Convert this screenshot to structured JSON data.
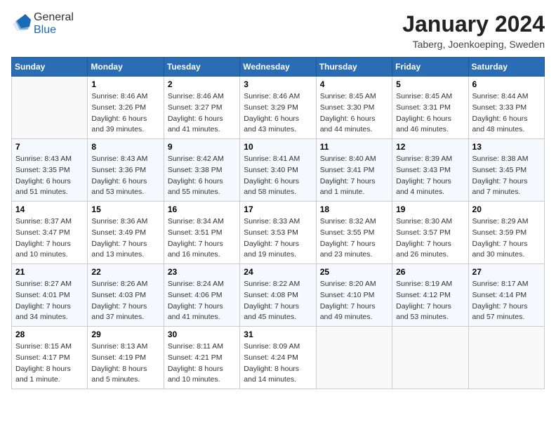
{
  "header": {
    "logo": {
      "general": "General",
      "blue": "Blue"
    },
    "title": "January 2024",
    "location": "Taberg, Joenkoeping, Sweden"
  },
  "days_of_week": [
    "Sunday",
    "Monday",
    "Tuesday",
    "Wednesday",
    "Thursday",
    "Friday",
    "Saturday"
  ],
  "weeks": [
    [
      {
        "num": "",
        "sunrise": "",
        "sunset": "",
        "daylight": "",
        "empty": true
      },
      {
        "num": "1",
        "sunrise": "Sunrise: 8:46 AM",
        "sunset": "Sunset: 3:26 PM",
        "daylight": "Daylight: 6 hours and 39 minutes."
      },
      {
        "num": "2",
        "sunrise": "Sunrise: 8:46 AM",
        "sunset": "Sunset: 3:27 PM",
        "daylight": "Daylight: 6 hours and 41 minutes."
      },
      {
        "num": "3",
        "sunrise": "Sunrise: 8:46 AM",
        "sunset": "Sunset: 3:29 PM",
        "daylight": "Daylight: 6 hours and 43 minutes."
      },
      {
        "num": "4",
        "sunrise": "Sunrise: 8:45 AM",
        "sunset": "Sunset: 3:30 PM",
        "daylight": "Daylight: 6 hours and 44 minutes."
      },
      {
        "num": "5",
        "sunrise": "Sunrise: 8:45 AM",
        "sunset": "Sunset: 3:31 PM",
        "daylight": "Daylight: 6 hours and 46 minutes."
      },
      {
        "num": "6",
        "sunrise": "Sunrise: 8:44 AM",
        "sunset": "Sunset: 3:33 PM",
        "daylight": "Daylight: 6 hours and 48 minutes."
      }
    ],
    [
      {
        "num": "7",
        "sunrise": "Sunrise: 8:43 AM",
        "sunset": "Sunset: 3:35 PM",
        "daylight": "Daylight: 6 hours and 51 minutes."
      },
      {
        "num": "8",
        "sunrise": "Sunrise: 8:43 AM",
        "sunset": "Sunset: 3:36 PM",
        "daylight": "Daylight: 6 hours and 53 minutes."
      },
      {
        "num": "9",
        "sunrise": "Sunrise: 8:42 AM",
        "sunset": "Sunset: 3:38 PM",
        "daylight": "Daylight: 6 hours and 55 minutes."
      },
      {
        "num": "10",
        "sunrise": "Sunrise: 8:41 AM",
        "sunset": "Sunset: 3:40 PM",
        "daylight": "Daylight: 6 hours and 58 minutes."
      },
      {
        "num": "11",
        "sunrise": "Sunrise: 8:40 AM",
        "sunset": "Sunset: 3:41 PM",
        "daylight": "Daylight: 7 hours and 1 minute."
      },
      {
        "num": "12",
        "sunrise": "Sunrise: 8:39 AM",
        "sunset": "Sunset: 3:43 PM",
        "daylight": "Daylight: 7 hours and 4 minutes."
      },
      {
        "num": "13",
        "sunrise": "Sunrise: 8:38 AM",
        "sunset": "Sunset: 3:45 PM",
        "daylight": "Daylight: 7 hours and 7 minutes."
      }
    ],
    [
      {
        "num": "14",
        "sunrise": "Sunrise: 8:37 AM",
        "sunset": "Sunset: 3:47 PM",
        "daylight": "Daylight: 7 hours and 10 minutes."
      },
      {
        "num": "15",
        "sunrise": "Sunrise: 8:36 AM",
        "sunset": "Sunset: 3:49 PM",
        "daylight": "Daylight: 7 hours and 13 minutes."
      },
      {
        "num": "16",
        "sunrise": "Sunrise: 8:34 AM",
        "sunset": "Sunset: 3:51 PM",
        "daylight": "Daylight: 7 hours and 16 minutes."
      },
      {
        "num": "17",
        "sunrise": "Sunrise: 8:33 AM",
        "sunset": "Sunset: 3:53 PM",
        "daylight": "Daylight: 7 hours and 19 minutes."
      },
      {
        "num": "18",
        "sunrise": "Sunrise: 8:32 AM",
        "sunset": "Sunset: 3:55 PM",
        "daylight": "Daylight: 7 hours and 23 minutes."
      },
      {
        "num": "19",
        "sunrise": "Sunrise: 8:30 AM",
        "sunset": "Sunset: 3:57 PM",
        "daylight": "Daylight: 7 hours and 26 minutes."
      },
      {
        "num": "20",
        "sunrise": "Sunrise: 8:29 AM",
        "sunset": "Sunset: 3:59 PM",
        "daylight": "Daylight: 7 hours and 30 minutes."
      }
    ],
    [
      {
        "num": "21",
        "sunrise": "Sunrise: 8:27 AM",
        "sunset": "Sunset: 4:01 PM",
        "daylight": "Daylight: 7 hours and 34 minutes."
      },
      {
        "num": "22",
        "sunrise": "Sunrise: 8:26 AM",
        "sunset": "Sunset: 4:03 PM",
        "daylight": "Daylight: 7 hours and 37 minutes."
      },
      {
        "num": "23",
        "sunrise": "Sunrise: 8:24 AM",
        "sunset": "Sunset: 4:06 PM",
        "daylight": "Daylight: 7 hours and 41 minutes."
      },
      {
        "num": "24",
        "sunrise": "Sunrise: 8:22 AM",
        "sunset": "Sunset: 4:08 PM",
        "daylight": "Daylight: 7 hours and 45 minutes."
      },
      {
        "num": "25",
        "sunrise": "Sunrise: 8:20 AM",
        "sunset": "Sunset: 4:10 PM",
        "daylight": "Daylight: 7 hours and 49 minutes."
      },
      {
        "num": "26",
        "sunrise": "Sunrise: 8:19 AM",
        "sunset": "Sunset: 4:12 PM",
        "daylight": "Daylight: 7 hours and 53 minutes."
      },
      {
        "num": "27",
        "sunrise": "Sunrise: 8:17 AM",
        "sunset": "Sunset: 4:14 PM",
        "daylight": "Daylight: 7 hours and 57 minutes."
      }
    ],
    [
      {
        "num": "28",
        "sunrise": "Sunrise: 8:15 AM",
        "sunset": "Sunset: 4:17 PM",
        "daylight": "Daylight: 8 hours and 1 minute."
      },
      {
        "num": "29",
        "sunrise": "Sunrise: 8:13 AM",
        "sunset": "Sunset: 4:19 PM",
        "daylight": "Daylight: 8 hours and 5 minutes."
      },
      {
        "num": "30",
        "sunrise": "Sunrise: 8:11 AM",
        "sunset": "Sunset: 4:21 PM",
        "daylight": "Daylight: 8 hours and 10 minutes."
      },
      {
        "num": "31",
        "sunrise": "Sunrise: 8:09 AM",
        "sunset": "Sunset: 4:24 PM",
        "daylight": "Daylight: 8 hours and 14 minutes."
      },
      {
        "num": "",
        "sunrise": "",
        "sunset": "",
        "daylight": "",
        "empty": true
      },
      {
        "num": "",
        "sunrise": "",
        "sunset": "",
        "daylight": "",
        "empty": true
      },
      {
        "num": "",
        "sunrise": "",
        "sunset": "",
        "daylight": "",
        "empty": true
      }
    ]
  ]
}
